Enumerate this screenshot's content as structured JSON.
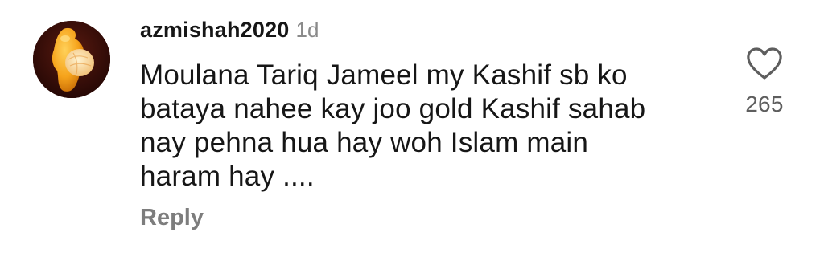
{
  "comment": {
    "username": "azmishah2020",
    "timestamp": "1d",
    "text_lines": [
      "Moulana Tariq Jameel my Kashif sb ko",
      "bataya nahee kay joo gold Kashif sahab",
      "nay pehna hua hay woh Islam main",
      "haram hay ...."
    ],
    "reply_label": "Reply",
    "like_count": "265",
    "avatar_icon": "orange-avatar-icon",
    "like_icon": "heart-outline-icon"
  },
  "colors": {
    "username": "#161616",
    "timestamp": "#8a8a8a",
    "reply": "#7d7d7d",
    "like_count": "#5e5e5e",
    "avatar_bg": "#3a0d09",
    "orange": "#f5a623"
  }
}
